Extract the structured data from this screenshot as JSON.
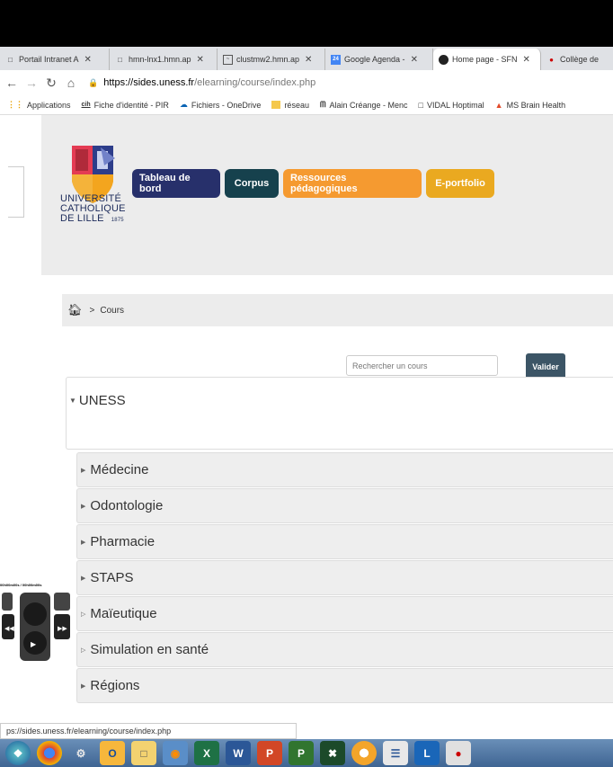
{
  "tabs": [
    {
      "title": "Portail Intranet A",
      "icon": "page-icon",
      "active": false
    },
    {
      "title": "hmn-lnx1.hmn.ap",
      "icon": "page-icon",
      "active": false
    },
    {
      "title": "clustmw2.hmn.ap",
      "icon": "chart-icon",
      "active": false
    },
    {
      "title": "Google Agenda -",
      "icon": "calendar-icon",
      "active": false
    },
    {
      "title": "Home page - SFN",
      "icon": "sfn-icon",
      "active": true
    },
    {
      "title": "Collège de",
      "icon": "college-icon",
      "active": false
    }
  ],
  "calendar_day": "24",
  "address": {
    "domain": "https://sides.uness.fr",
    "path": "/elearning/course/index.php"
  },
  "bookmarks": [
    {
      "label": "Applications",
      "icon": "apps-grid-icon"
    },
    {
      "label": "Fiche d'identité - PIR",
      "icon": "cih-icon",
      "icon_text": "cih"
    },
    {
      "label": "Fichiers - OneDrive",
      "icon": "onedrive-icon"
    },
    {
      "label": "réseau",
      "icon": "folder-icon"
    },
    {
      "label": "Alain Créange - Menc",
      "icon": "mendeley-icon"
    },
    {
      "label": "VIDAL Hoptimal",
      "icon": "page-icon"
    },
    {
      "label": "MS Brain Health",
      "icon": "ms-brain-icon"
    }
  ],
  "university": {
    "line1": "UNIVERSITÉ",
    "line2": "CATHOLIQUE",
    "line3": "DE LILLE",
    "year": "1875"
  },
  "nav": {
    "tableau": "Tableau de bord",
    "corpus": "Corpus",
    "ressources": "Ressources pédagogiques",
    "eportfolio": "E-portfolio"
  },
  "breadcrumb": {
    "current": "Cours"
  },
  "search": {
    "placeholder": "Rechercher un cours",
    "button": "Valider"
  },
  "root_category": "UNESS",
  "categories": [
    {
      "label": "Médecine",
      "expandable": true
    },
    {
      "label": "Odontologie",
      "expandable": true
    },
    {
      "label": "Pharmacie",
      "expandable": true
    },
    {
      "label": "STAPS",
      "expandable": true
    },
    {
      "label": "Maïeutique",
      "expandable": false
    },
    {
      "label": "Simulation en santé",
      "expandable": false
    },
    {
      "label": "Régions",
      "expandable": true
    }
  ],
  "media_player": {
    "time": "00h00m00s / 00h00m00s"
  },
  "status_url": "ps://sides.uness.fr/elearning/course/index.php",
  "taskbar": [
    "start-orb-icon",
    "chrome-icon",
    "network-icon",
    "outlook-icon",
    "explorer-icon",
    "player-icon",
    "excel-icon",
    "word-icon",
    "powerpoint-icon",
    "project-icon",
    "xcode-icon",
    "chrome-canary-icon",
    "notepad-icon",
    "lync-icon",
    "browser-icon"
  ],
  "colors": {
    "tableau": "#27306b",
    "corpus": "#16414d",
    "ressources": "#f59a30",
    "eportfolio": "#eaa920",
    "valider": "#3c5566"
  }
}
